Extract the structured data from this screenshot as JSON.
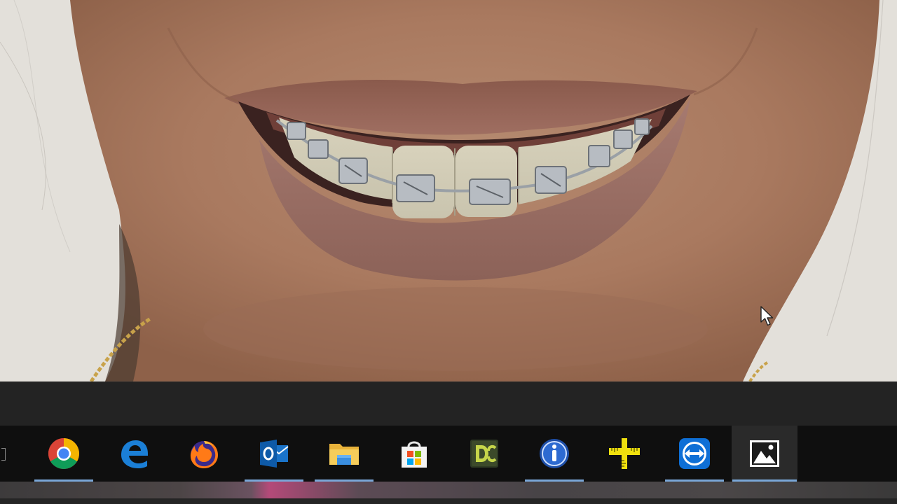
{
  "viewer": {
    "image_name": "photo-smile-with-braces"
  },
  "taskbar": {
    "items": [
      {
        "icon": "chrome-icon",
        "running": true
      },
      {
        "icon": "edge-icon",
        "running": false
      },
      {
        "icon": "firefox-icon",
        "running": false
      },
      {
        "icon": "outlook-icon",
        "running": true
      },
      {
        "icon": "file-explorer-icon",
        "running": true
      },
      {
        "icon": "microsoft-store-icon",
        "running": false
      },
      {
        "icon": "dc-app-icon",
        "running": false
      },
      {
        "icon": "info-app-icon",
        "running": true
      },
      {
        "icon": "ruler-app-icon",
        "running": false
      },
      {
        "icon": "teamviewer-icon",
        "running": true
      },
      {
        "icon": "photos-icon",
        "running": true,
        "active": true
      }
    ]
  },
  "colors": {
    "taskbar_bg": "#0f0f0f",
    "running_indicator": "#7aa7d8",
    "active_bg": "#2a2a2a"
  }
}
